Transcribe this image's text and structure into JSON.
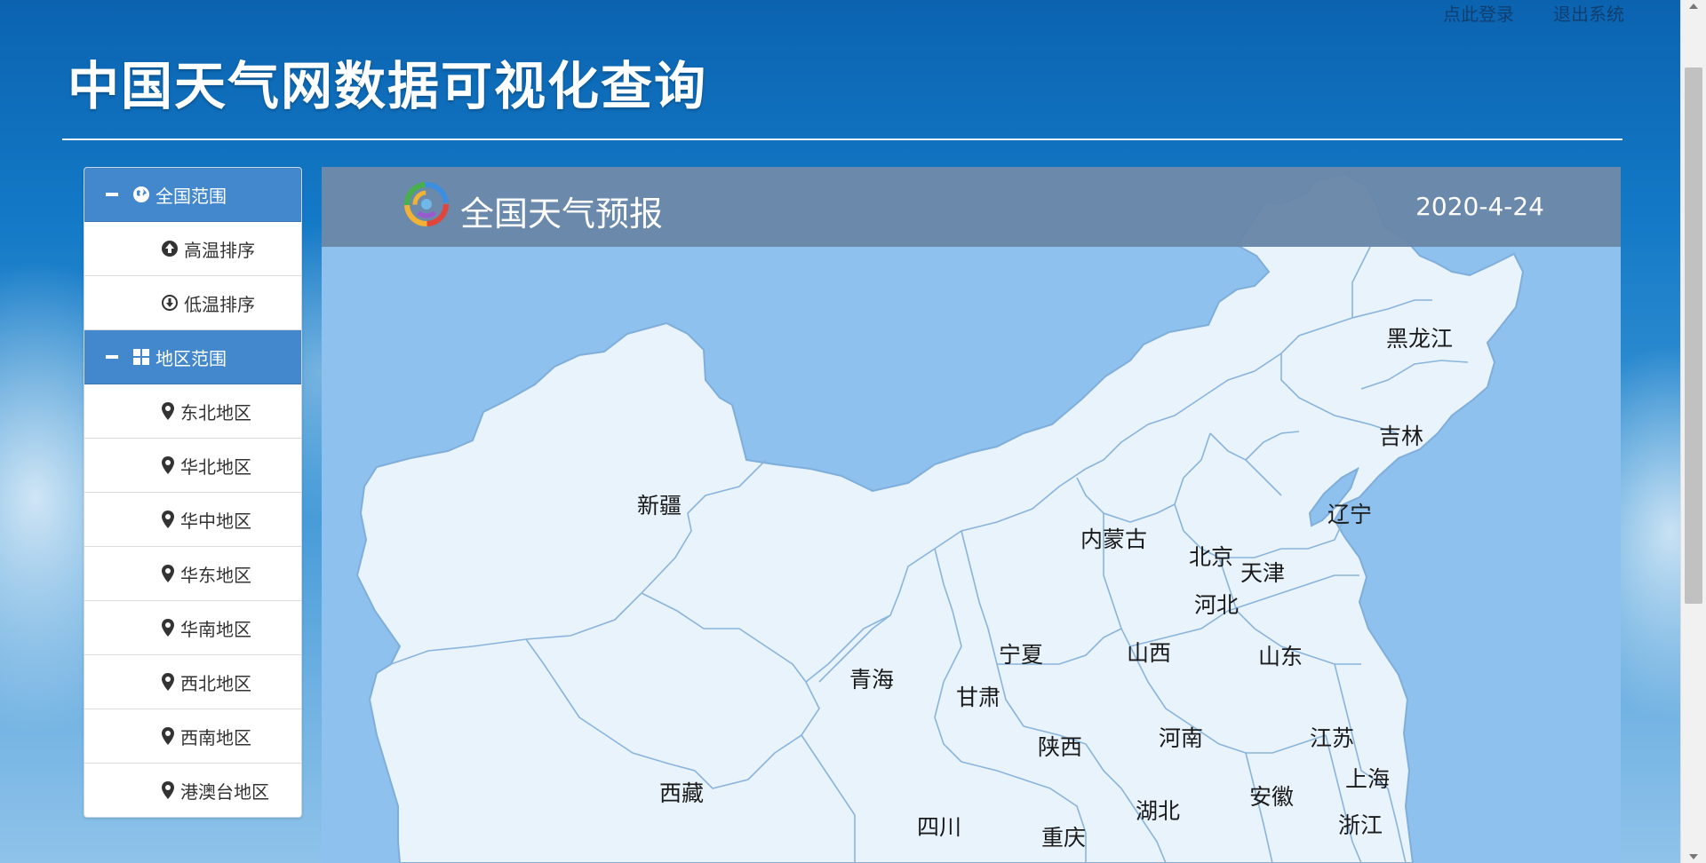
{
  "header": {
    "title": "中国天气网数据可视化查询",
    "login_link": "点此登录",
    "logout_link": "退出系统"
  },
  "sidebar": {
    "groups": [
      {
        "label": "全国范围",
        "icon": "globe-icon",
        "items": [
          {
            "label": "高温排序",
            "icon": "arrow-up-circle-icon"
          },
          {
            "label": "低温排序",
            "icon": "arrow-down-circle-icon"
          }
        ]
      },
      {
        "label": "地区范围",
        "icon": "grid-icon",
        "items": [
          {
            "label": "东北地区",
            "icon": "map-marker-icon"
          },
          {
            "label": "华北地区",
            "icon": "map-marker-icon"
          },
          {
            "label": "华中地区",
            "icon": "map-marker-icon"
          },
          {
            "label": "华东地区",
            "icon": "map-marker-icon"
          },
          {
            "label": "华南地区",
            "icon": "map-marker-icon"
          },
          {
            "label": "西北地区",
            "icon": "map-marker-icon"
          },
          {
            "label": "西南地区",
            "icon": "map-marker-icon"
          },
          {
            "label": "港澳台地区",
            "icon": "map-marker-icon"
          }
        ]
      }
    ]
  },
  "panel": {
    "logo_icon": "weather-logo-icon",
    "title": "全国天气预报",
    "date": "2020-4-24"
  },
  "map": {
    "provinces": [
      "新疆",
      "西藏",
      "青海",
      "甘肃",
      "宁夏",
      "内蒙古",
      "黑龙江",
      "吉林",
      "辽宁",
      "北京",
      "天津",
      "河北",
      "山西",
      "山东",
      "陕西",
      "河南",
      "江苏",
      "上海",
      "安徽",
      "湖北",
      "浙江",
      "四川",
      "重庆"
    ]
  },
  "colors": {
    "accent": "#4388cc",
    "panel_header": "#6987a8",
    "map_water": "#8fc1ee",
    "map_land": "#e8f3fc",
    "map_border": "#8ab4dc"
  }
}
